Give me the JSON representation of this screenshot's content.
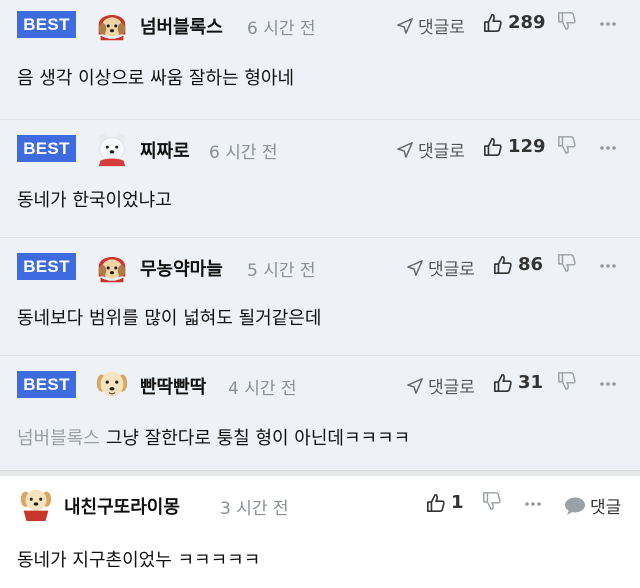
{
  "comments": [
    {
      "best": true,
      "badge": "BEST",
      "nick": "넘버블록스",
      "time": "6 시간 전",
      "reply": "댓글로",
      "likes": "289",
      "text": "음 생각 이상으로 싸움 잘하는 형아네",
      "avatar": "dog-red-hood"
    },
    {
      "best": true,
      "badge": "BEST",
      "nick": "찌짜로",
      "time": "6 시간 전",
      "reply": "댓글로",
      "likes": "129",
      "text": "동네가 한국이었냐고",
      "avatar": "white-bear"
    },
    {
      "best": true,
      "badge": "BEST",
      "nick": "무농약마늘",
      "time": "5 시간 전",
      "reply": "댓글로",
      "likes": "86",
      "text": "동네보다 범위를 많이 넓혀도 될거같은데",
      "avatar": "dog-red-hood"
    },
    {
      "best": true,
      "badge": "BEST",
      "nick": "빤딱빤딱",
      "time": "4 시간 전",
      "reply": "댓글로",
      "likes": "31",
      "mention": "넘버블록스",
      "text": "그냥 잘한다로 퉁칠 형이 아닌데ㅋㅋㅋㅋ",
      "avatar": "puppy"
    },
    {
      "best": false,
      "nick": "내친구또라이몽",
      "time": "3 시간 전",
      "reply": "댓글",
      "likes": "1",
      "text": "동네가 지구촌이었누 ㅋㅋㅋㅋㅋ",
      "avatar": "puppy-red-cape"
    }
  ],
  "colors": {
    "best_badge": "#3e6be0",
    "best_bg": "#eef1f6",
    "muted": "#8a8f98"
  }
}
